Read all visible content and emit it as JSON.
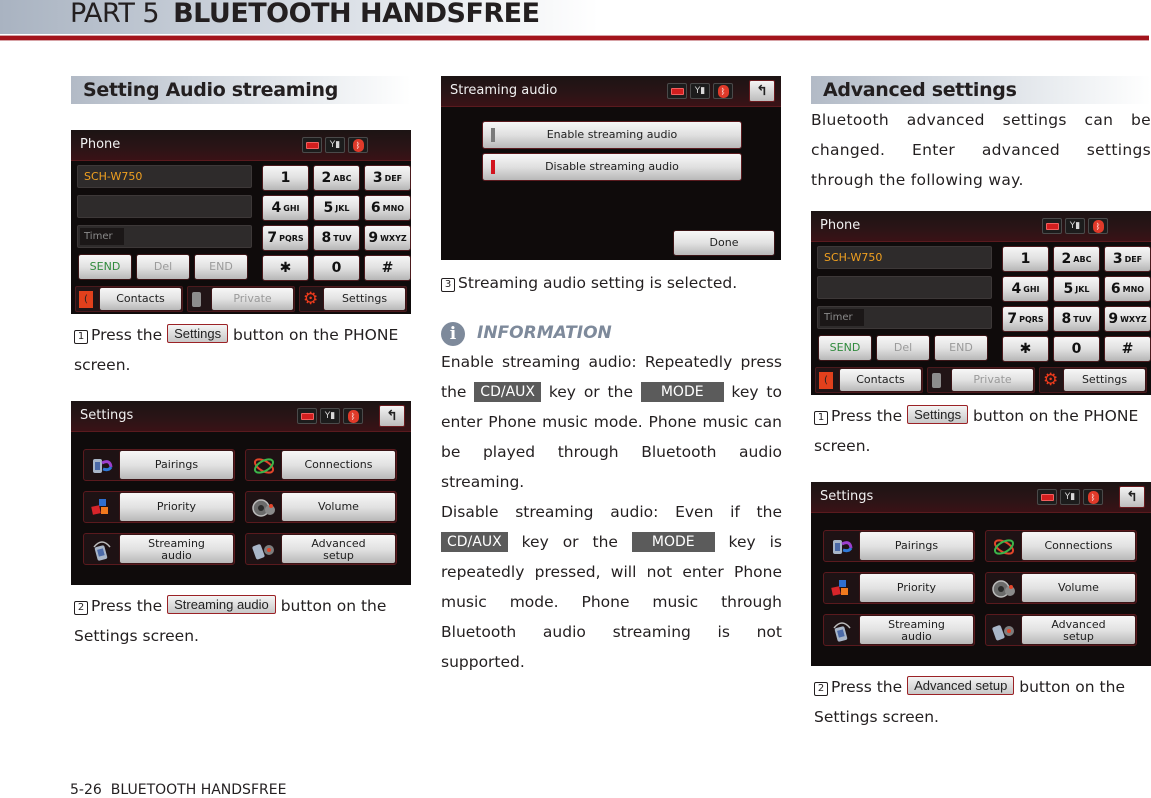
{
  "header": {
    "part": "PART 5",
    "chapter": "BLUETOOTH HANDSFREE"
  },
  "colors": {
    "accent_red": "#a3141c",
    "info_gray": "#7e8a9b",
    "key_tag_bg": "#5b5b5b",
    "device_orange": "#f0a020"
  },
  "left_column": {
    "section_title": "Setting Audio streaming",
    "step1": {
      "num": "1",
      "pre": "Press the ",
      "button": "Settings",
      "post": " button on the PHONE screen."
    },
    "step2": {
      "num": "2",
      "pre": "Press the ",
      "button": "Streaming audio",
      "post": " button on the Settings screen."
    }
  },
  "middle_column": {
    "step3": {
      "num": "3",
      "text": "Streaming audio setting is selected."
    },
    "info": {
      "icon": "info-icon",
      "label": "INFORMATION",
      "p1_a": "Enable streaming audio: Repeatedly press the ",
      "key_cdaux": "CD/AUX",
      "p1_b": " key or the ",
      "key_mode": "MODE",
      "p1_c": " key to enter Phone music mode. Phone music can be played through Bluetooth audio streaming.",
      "p2_a": "Disable streaming audio: Even if the ",
      "p2_b": " key or the ",
      "p2_c": " key is repeatedly pressed, will not enter Phone music mode. Phone music through Bluetooth audio streaming is not supported."
    }
  },
  "right_column": {
    "section_title": "Advanced settings",
    "intro": "Bluetooth advanced settings can be changed. Enter advanced settings through the following way.",
    "step1": {
      "num": "1",
      "pre": "Press the ",
      "button": "Settings",
      "post": " button on the PHONE screen."
    },
    "step2": {
      "num": "2",
      "pre": "Press the ",
      "button": "Advanced setup",
      "post": " button on the Settings screen."
    }
  },
  "phone_screen": {
    "title": "Phone",
    "device_name": "SCH-W750",
    "timer_label": "Timer",
    "action_buttons": [
      "SEND",
      "Del",
      "END"
    ],
    "keypad": [
      {
        "digit": "1",
        "letters": ""
      },
      {
        "digit": "2",
        "letters": "ABC"
      },
      {
        "digit": "3",
        "letters": "DEF"
      },
      {
        "digit": "4",
        "letters": "GHI"
      },
      {
        "digit": "5",
        "letters": "JKL"
      },
      {
        "digit": "6",
        "letters": "MNO"
      },
      {
        "digit": "7",
        "letters": "PQRS"
      },
      {
        "digit": "8",
        "letters": "TUV"
      },
      {
        "digit": "9",
        "letters": "WXYZ"
      },
      {
        "digit": "✱",
        "letters": ""
      },
      {
        "digit": "0",
        "letters": ""
      },
      {
        "digit": "#",
        "letters": ""
      }
    ],
    "bottom_buttons": [
      "Contacts",
      "Private",
      "Settings"
    ],
    "status_icons": [
      "battery-icon",
      "signal-icon",
      "bluetooth-icon"
    ]
  },
  "settings_screen": {
    "title": "Settings",
    "back_glyph": "⮌",
    "menu": [
      {
        "label": "Pairings",
        "icon": "pairings-icon"
      },
      {
        "label": "Connections",
        "icon": "connections-icon"
      },
      {
        "label": "Priority",
        "icon": "priority-icon"
      },
      {
        "label": "Volume",
        "icon": "volume-icon"
      },
      {
        "label": "Streaming\naudio",
        "line1": "Streaming",
        "line2": "audio",
        "icon": "streaming-icon"
      },
      {
        "label": "Advanced\nsetup",
        "line1": "Advanced",
        "line2": "setup",
        "icon": "advanced-setup-icon"
      }
    ]
  },
  "streaming_screen": {
    "title": "Streaming audio",
    "back_glyph": "⮌",
    "options": [
      {
        "label": "Enable streaming audio",
        "selected": false
      },
      {
        "label": "Disable streaming audio",
        "selected": true
      }
    ],
    "done_label": "Done"
  },
  "footer": {
    "page": "5-26",
    "chapter": "BLUETOOTH HANDSFREE"
  }
}
